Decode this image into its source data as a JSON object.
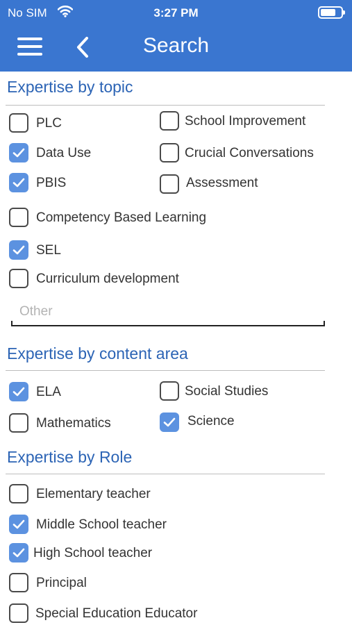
{
  "status_bar": {
    "carrier": "No SIM",
    "time": "3:27 PM"
  },
  "header": {
    "title": "Search",
    "menu_icon": "hamburger-menu-icon",
    "back_icon": "chevron-left-icon",
    "background_color": "#3a76d0"
  },
  "colors": {
    "section_title": "#2c64b5",
    "checkbox_checked": "#5c92e0"
  },
  "topic": {
    "title": "Expertise by topic",
    "items": [
      {
        "label": "PLC",
        "checked": false
      },
      {
        "label": "School Improvement",
        "checked": false
      },
      {
        "label": "Data Use",
        "checked": true
      },
      {
        "label": "Crucial Conversations",
        "checked": false
      },
      {
        "label": "PBIS",
        "checked": true
      },
      {
        "label": "Assessment",
        "checked": false
      },
      {
        "label": "Competency Based Learning",
        "checked": false
      },
      {
        "label": "SEL",
        "checked": true
      },
      {
        "label": "Curriculum development",
        "checked": false
      }
    ],
    "other": {
      "placeholder": "Other",
      "value": ""
    }
  },
  "content_area": {
    "title": "Expertise by content area",
    "items": [
      {
        "label": "ELA",
        "checked": true
      },
      {
        "label": "Social Studies",
        "checked": false
      },
      {
        "label": "Mathematics",
        "checked": false
      },
      {
        "label": "Science",
        "checked": true
      }
    ]
  },
  "role": {
    "title": "Expertise by Role",
    "items": [
      {
        "label": "Elementary teacher",
        "checked": false
      },
      {
        "label": "Middle School teacher",
        "checked": true
      },
      {
        "label": "High School teacher",
        "checked": true
      },
      {
        "label": "Principal",
        "checked": false
      },
      {
        "label": "Special Education Educator",
        "checked": false
      }
    ]
  }
}
